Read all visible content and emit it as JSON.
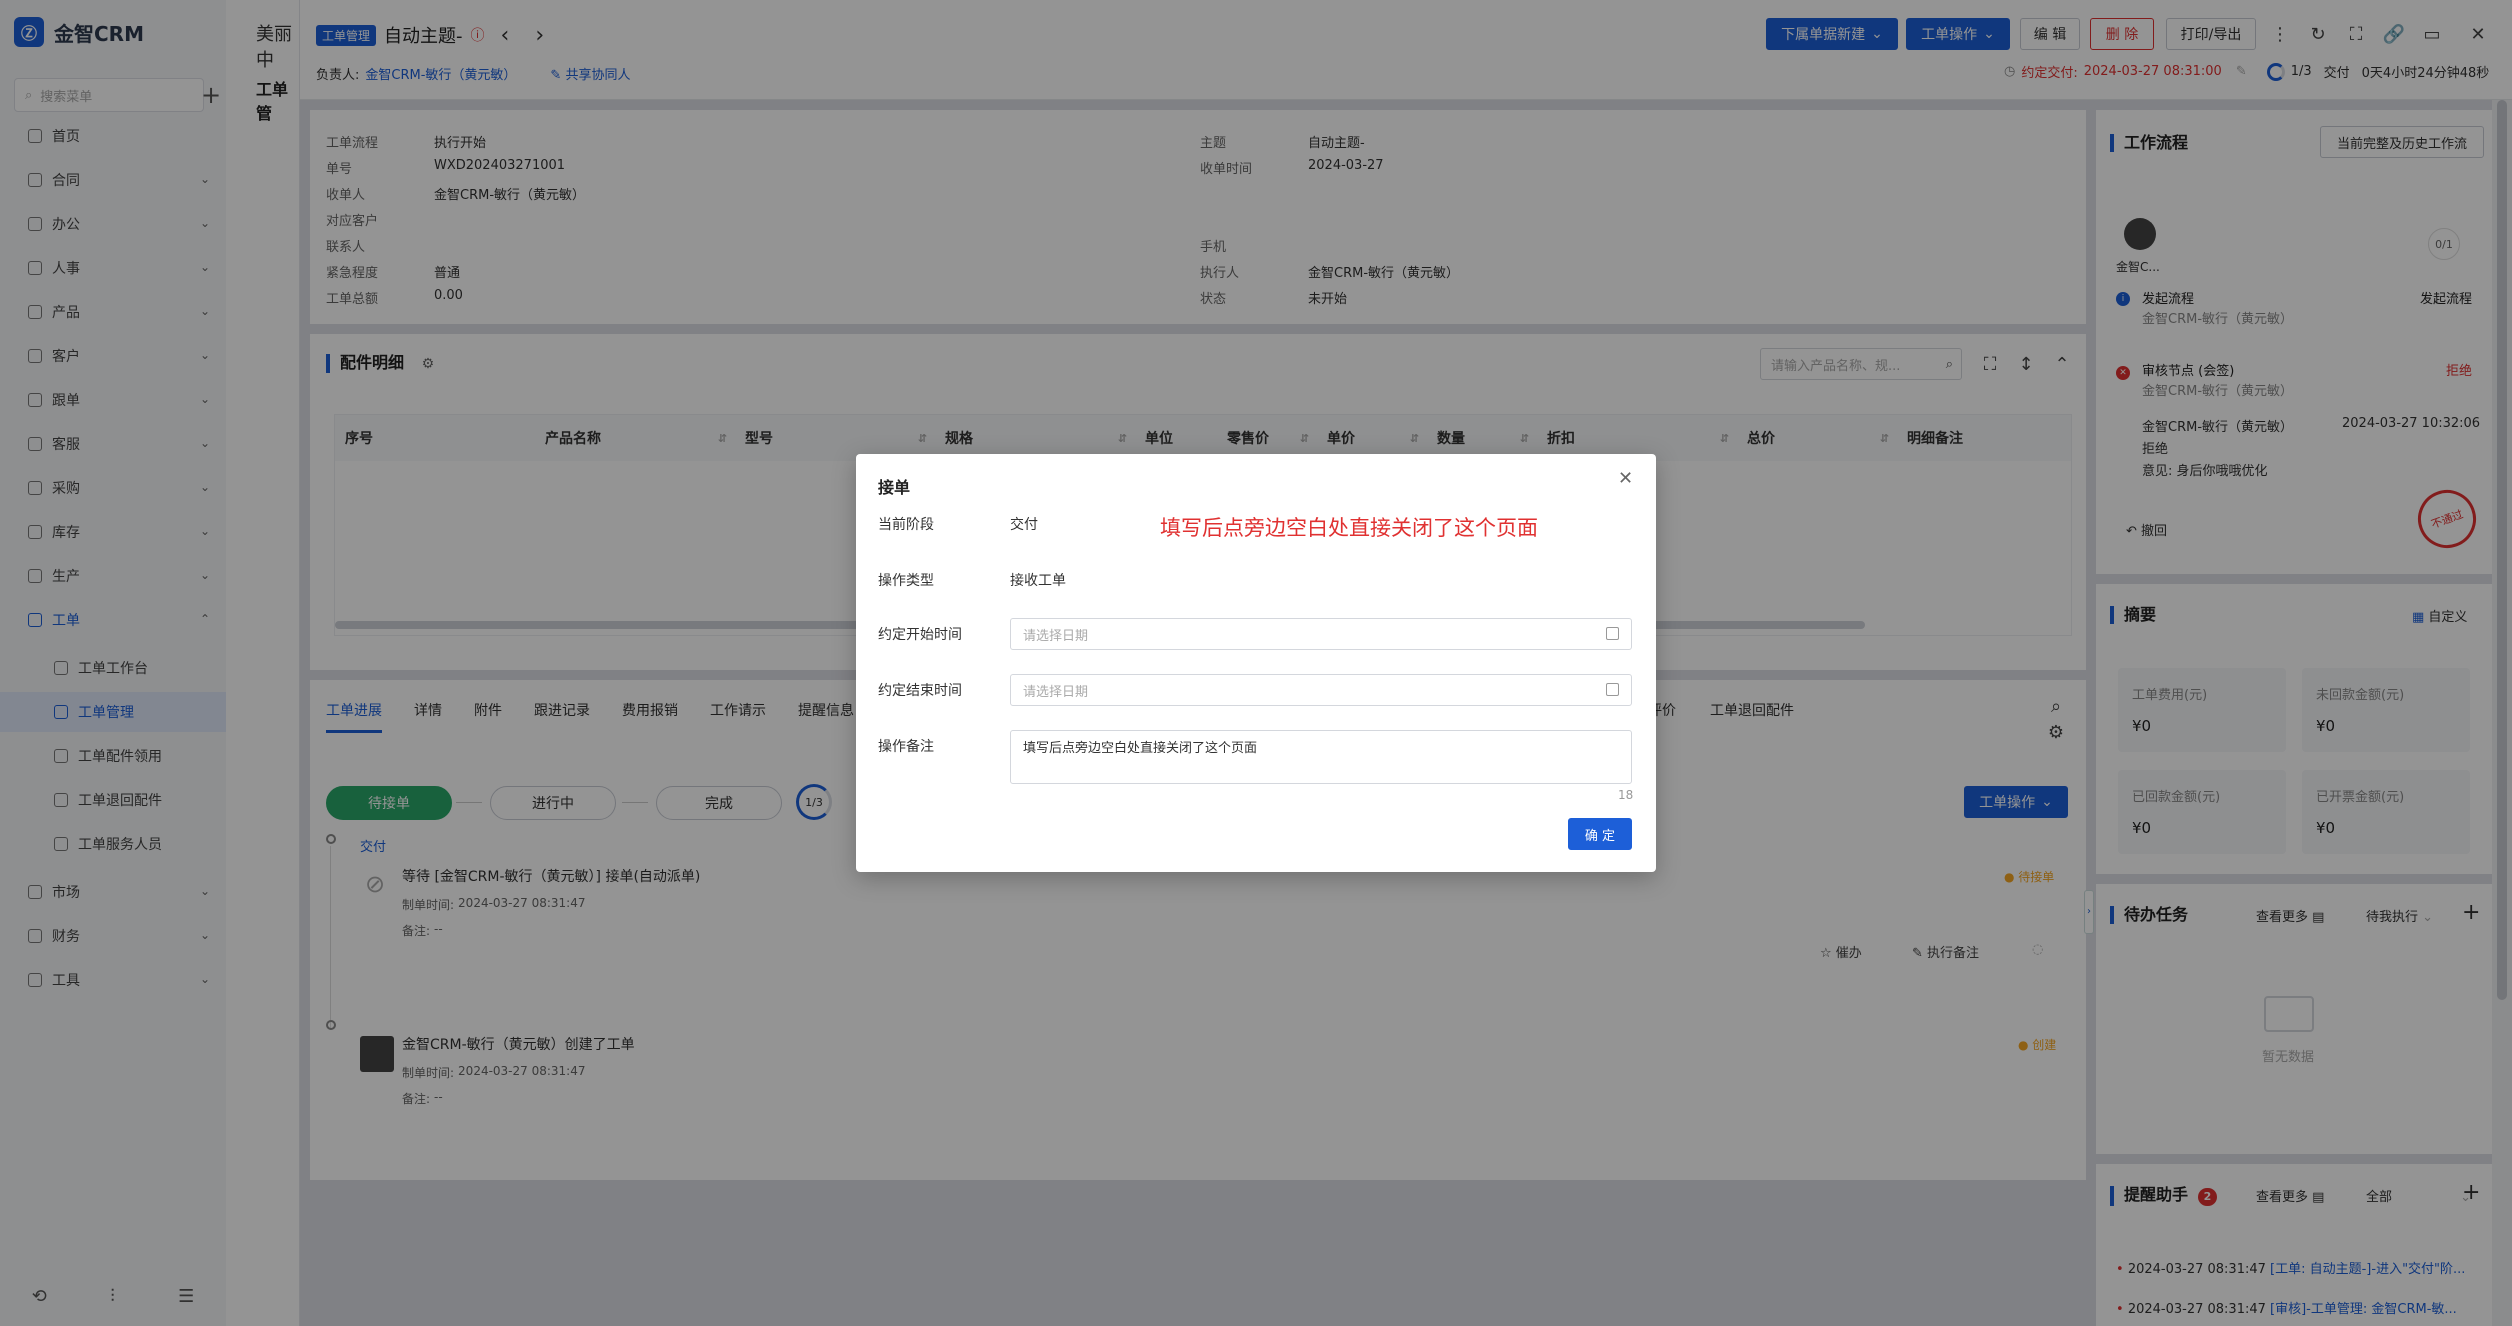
{
  "app": {
    "name": "金智CRM",
    "crumb": "美丽中"
  },
  "sidebar": {
    "search_placeholder": "搜索菜单",
    "items": [
      {
        "label": "首页",
        "chevron": false
      },
      {
        "label": "合同",
        "chevron": true
      },
      {
        "label": "办公",
        "chevron": true
      },
      {
        "label": "人事",
        "chevron": true
      },
      {
        "label": "产品",
        "chevron": true
      },
      {
        "label": "客户",
        "chevron": true
      },
      {
        "label": "跟单",
        "chevron": true
      },
      {
        "label": "客服",
        "chevron": true
      },
      {
        "label": "采购",
        "chevron": true
      },
      {
        "label": "库存",
        "chevron": true
      },
      {
        "label": "生产",
        "chevron": true
      },
      {
        "label": "工单",
        "chevron": true,
        "open": true
      }
    ],
    "sub_items": [
      "工单工作台",
      "工单管理",
      "工单配件领用",
      "工单退回配件",
      "工单服务人员"
    ],
    "items_after": [
      {
        "label": "市场"
      },
      {
        "label": "财务"
      },
      {
        "label": "工具"
      }
    ],
    "subnav_title": "工单管"
  },
  "header": {
    "tag": "工单管理",
    "title": "自动主题-",
    "owner_label": "负责人:",
    "owner": "金智CRM-敏行（黄元敏）",
    "share": "共享协同人",
    "buttons": {
      "new_sub": "下属单据新建",
      "ops": "工单操作",
      "edit": "编 辑",
      "delete": "删 除",
      "print": "打印/导出"
    },
    "deadline_label": "约定交付:",
    "deadline": "2024-03-27 08:31:00",
    "progress": "1/3",
    "stage_label": "交付",
    "elapsed": "0天4小时24分钟48秒"
  },
  "info": {
    "left": [
      {
        "k": "工单流程",
        "v": "执行开始"
      },
      {
        "k": "单号",
        "v": "WXD202403271001"
      },
      {
        "k": "收单人",
        "v": "金智CRM-敏行（黄元敏）"
      },
      {
        "k": "对应客户",
        "v": ""
      },
      {
        "k": "联系人",
        "v": ""
      },
      {
        "k": "紧急程度",
        "v": "普通"
      },
      {
        "k": "工单总额",
        "v": "0.00"
      }
    ],
    "right": [
      {
        "k": "主题",
        "v": "自动主题-"
      },
      {
        "k": "收单时间",
        "v": "2024-03-27"
      },
      {
        "k": "",
        "v": ""
      },
      {
        "k": "",
        "v": ""
      },
      {
        "k": "手机",
        "v": ""
      },
      {
        "k": "执行人",
        "v": "金智CRM-敏行（黄元敏）"
      },
      {
        "k": "状态",
        "v": "未开始"
      }
    ]
  },
  "parts": {
    "title": "配件明细",
    "search_placeholder": "请输入产品名称、规...",
    "columns": [
      "序号",
      "产品名称",
      "型号",
      "规格",
      "单位",
      "零售价",
      "单价",
      "数量",
      "折扣",
      "总价",
      "明细备注"
    ]
  },
  "tabs": [
    "工单进展",
    "详情",
    "附件",
    "跟进记录",
    "费用报销",
    "工作请示",
    "提醒信息",
    "评价",
    "工单退回配件"
  ],
  "progress": {
    "stages": [
      "待接单",
      "进行中",
      "完成"
    ],
    "count": "1/3",
    "ops_button": "工单操作",
    "stage_name": "交付",
    "entries": [
      {
        "title": "等待 [金智CRM-敏行（黄元敏）] 接单(自动派单)",
        "time_label": "制单时间:",
        "time": "2024-03-27 08:31:47",
        "note_label": "备注:",
        "note": "--",
        "status": "待接单",
        "actions": [
          "催办",
          "执行备注"
        ]
      },
      {
        "title": "金智CRM-敏行（黄元敏）创建了工单",
        "time_label": "制单时间:",
        "time": "2024-03-27 08:31:47",
        "note_label": "备注:",
        "note": "--",
        "status": "创建"
      }
    ]
  },
  "workflow": {
    "title": "工作流程",
    "history_button": "当前完整及历史工作流",
    "user": "金智C...",
    "count": "0/1",
    "steps": [
      {
        "name": "发起流程",
        "person": "金智CRM-敏行（黄元敏）",
        "status": "发起流程"
      },
      {
        "name": "审核节点 (会签)",
        "person": "金智CRM-敏行（黄元敏）",
        "status": "拒绝"
      }
    ],
    "detail": {
      "person": "金智CRM-敏行（黄元敏）",
      "time": "2024-03-27 10:32:06",
      "result": "拒绝",
      "opinion": "意见: 身后你哦哦优化"
    },
    "withdraw": "撤回",
    "stamp": "不通过"
  },
  "summary": {
    "title": "摘要",
    "custom": "自定义",
    "stats": [
      {
        "label": "工单费用(元)",
        "value": "¥0"
      },
      {
        "label": "未回款金额(元)",
        "value": "¥0"
      },
      {
        "label": "已回款金额(元)",
        "value": "¥0"
      },
      {
        "label": "已开票金额(元)",
        "value": "¥0"
      }
    ]
  },
  "todo": {
    "title": "待办任务",
    "more": "查看更多",
    "filter": "待我执行",
    "empty": "暂无数据"
  },
  "reminder": {
    "title": "提醒助手",
    "badge": "2",
    "more": "查看更多",
    "filter": "全部",
    "items": [
      {
        "time": "2024-03-27 08:31:47",
        "text": "[工单: 自动主题-]-进入\"交付\"阶..."
      },
      {
        "time": "2024-03-27 08:31:47",
        "text": "[审核]-工单管理: 金智CRM-敏..."
      }
    ]
  },
  "modal": {
    "title": "接单",
    "stage_label": "当前阶段",
    "stage": "交付",
    "annotation": "填写后点旁边空白处直接关闭了这个页面",
    "type_label": "操作类型",
    "type": "接收工单",
    "start_label": "约定开始时间",
    "start_placeholder": "请选择日期",
    "end_label": "约定结束时间",
    "end_placeholder": "请选择日期",
    "note_label": "操作备注",
    "note": "填写后点旁边空白处直接关闭了这个页面",
    "char_count": "18",
    "confirm": "确 定"
  },
  "colors": {
    "accent": "#1d5fd8",
    "danger": "#e03131",
    "success": "#2aa86a",
    "warning": "#f5a623"
  }
}
